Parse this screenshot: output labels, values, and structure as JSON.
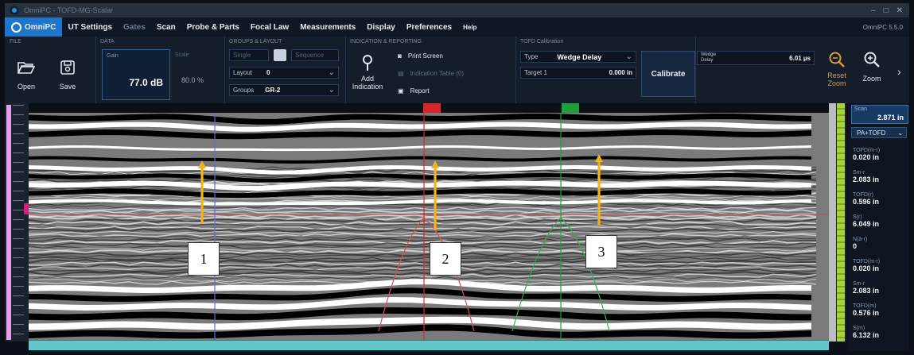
{
  "window": {
    "title": "OmniPC - TOFD-MG-Scalar"
  },
  "menu": {
    "app": "OmniPC",
    "items": [
      "UT Settings",
      "Gates",
      "Scan",
      "Probe & Parts",
      "Focal Law",
      "Measurements",
      "Display",
      "Preferences",
      "Help"
    ],
    "version": "OmniPC 5.5.0"
  },
  "ribbon": {
    "file": {
      "label": "FILE",
      "open": "Open",
      "save": "Save"
    },
    "data": {
      "label": "DATA",
      "gain_label": "Gain",
      "gain_value": "77.0 dB",
      "secondary_label": "Scale",
      "secondary_value": "80.0 %"
    },
    "display": {
      "label": "GROUPS & LAYOUT",
      "single": "Single",
      "layout_label": "Layout",
      "layout_value": "0",
      "groups_label": "Groups",
      "groups_value": "GR-2",
      "sequence": "Sequence"
    },
    "indications": {
      "label": "INDICATION & REPORTING",
      "add_indication": "Add Indication",
      "print_screen": "Print Screen",
      "indication_table": "Indication Table (0)",
      "report": "Report"
    },
    "tofd": {
      "label": "TOFD Calibration",
      "type_label": "Type",
      "type_value": "Wedge Delay",
      "target_label": "Target 1",
      "target_value": "0.000 in",
      "calibrate": "Calibrate",
      "wedge_label": "Wedge Delay",
      "wedge_value": "6.01 µs"
    },
    "view": {
      "reset_zoom": "Reset Zoom",
      "zoom": "Zoom"
    }
  },
  "readouts": {
    "scan_label": "Scan",
    "scan_value": "2.871 in",
    "mode": "PA+TOFD",
    "items": [
      {
        "label": "TOFD(m-r)",
        "value": "0.020 in"
      },
      {
        "label": "Sm-r",
        "value": "2.083 in"
      },
      {
        "label": "TOFD(r)",
        "value": "0.596 in"
      },
      {
        "label": "S(r)",
        "value": "6.049 in"
      },
      {
        "label": "N(a-r)",
        "value": "0"
      },
      {
        "label": "TOFD(m-r)",
        "value": "0.020 in"
      },
      {
        "label": "Sm-r",
        "value": "2.083 in"
      },
      {
        "label": "TOFD(m)",
        "value": "0.576 in"
      },
      {
        "label": "S(m)",
        "value": "6.132 in"
      }
    ]
  },
  "callouts": [
    "1",
    "2",
    "3"
  ],
  "colors": {
    "accent": "#1f75c9",
    "reference_cursor": "#d92727",
    "measure_cursor": "#1f9f3a",
    "arrow": "#f3b31b",
    "reset_zoom": "#e39a3a"
  }
}
